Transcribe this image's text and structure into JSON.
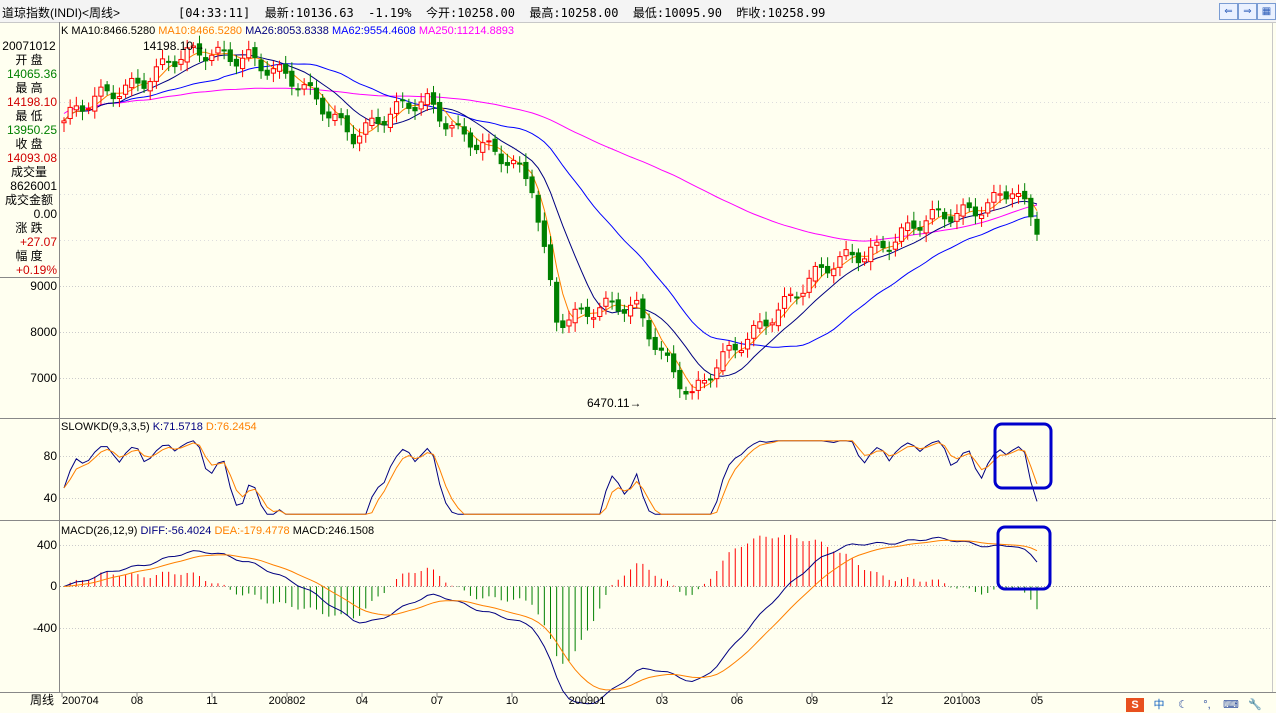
{
  "window": {
    "title": "道琼指数(INDI)<周线>",
    "info": "[04:33:11]  最新:10136.63  -1.19%  今开:10258.00  最高:10258.00  最低:10095.90  昨收:10258.99",
    "nav_buttons": [
      "prev-icon",
      "next-icon",
      "grid-icon"
    ]
  },
  "main_panel": {
    "legend": [
      {
        "text": "K",
        "color": "#000000"
      },
      {
        "text": "MA10:8466.5280",
        "color": "#000000"
      },
      {
        "text": "MA10:8466.5280",
        "color": "#ff8000"
      },
      {
        "text": "MA26:8053.8338",
        "color": "#000080"
      },
      {
        "text": "MA62:9554.4608",
        "color": "#0000ff"
      },
      {
        "text": "MA250:11214.8893",
        "color": "#ff00ff"
      }
    ],
    "high_marker": "14198.10→",
    "low_marker": "6470.11→",
    "yticks": [
      "9000",
      "8000",
      "7000"
    ]
  },
  "info_panel": {
    "date": "20071012",
    "open_label": "开  盘",
    "open": "14065.36",
    "high_label": "最  高",
    "high": "14198.10",
    "low_label": "最  低",
    "low": "13950.25",
    "close_label": "收  盘",
    "close": "14093.08",
    "vol_label": "成交量",
    "vol": "8626001",
    "amount_label": "成交金额",
    "amount": "0.00",
    "chg_label": "涨  跌",
    "chg": "+27.07",
    "pct_label": "幅  度",
    "pct": "+0.19%"
  },
  "kd_panel": {
    "legend": [
      {
        "text": "SLOWKD(9,3,3,5)",
        "color": "#000000"
      },
      {
        "text": "K:71.5718",
        "color": "#000080"
      },
      {
        "text": "D:76.2454",
        "color": "#ff8000"
      }
    ],
    "yticks": [
      "80",
      "40"
    ]
  },
  "macd_panel": {
    "legend": [
      {
        "text": "MACD(26,12,9)",
        "color": "#000000"
      },
      {
        "text": "DIFF:-56.4024",
        "color": "#000080"
      },
      {
        "text": "DEA:-179.4778",
        "color": "#ff8000"
      },
      {
        "text": "MACD:246.1508",
        "color": "#000000"
      }
    ],
    "yticks": [
      "400",
      "0",
      "-400"
    ]
  },
  "xaxis": {
    "label": "周线",
    "ticks": [
      "200704",
      "08",
      "11",
      "200802",
      "04",
      "07",
      "10",
      "200901",
      "03",
      "06",
      "09",
      "12",
      "201003",
      "05"
    ]
  },
  "status_icons": [
    "sogou-icon",
    "chinese-input-icon",
    "moon-icon",
    "punctuation-icon",
    "keyboard-icon",
    "wrench-icon"
  ],
  "chart_data": {
    "type": "candlestick",
    "title": "道琼指数(INDI)<周线>",
    "period": "weekly",
    "x_range": [
      "200704",
      "201005"
    ],
    "price_ylim": [
      6300,
      14500
    ],
    "price_keypoints": [
      {
        "date": "200704",
        "close": 12600
      },
      {
        "date": "200707",
        "close": 13900
      },
      {
        "date": "200710",
        "close": 14093.08
      },
      {
        "date": "200802",
        "close": 12400
      },
      {
        "date": "200805",
        "close": 13000
      },
      {
        "date": "200809",
        "close": 11200
      },
      {
        "date": "200810",
        "close": 8400
      },
      {
        "date": "200901",
        "close": 8500
      },
      {
        "date": "200903",
        "close": 6600
      },
      {
        "date": "200906",
        "close": 8500
      },
      {
        "date": "200909",
        "close": 9700
      },
      {
        "date": "200912",
        "close": 10400
      },
      {
        "date": "201004",
        "close": 11100
      },
      {
        "date": "201005",
        "close": 10136.63
      }
    ],
    "annotations": [
      {
        "label": "14198.10",
        "date": "200710",
        "value": 14198.1
      },
      {
        "label": "6470.11",
        "date": "200903",
        "value": 6470.11
      }
    ],
    "indicators": {
      "MA10": 8466.528,
      "MA26": 8053.8338,
      "MA62": 9554.4608,
      "MA250": 11214.8893,
      "SLOWKD": {
        "params": "9,3,3,5",
        "K": 71.5718,
        "D": 76.2454
      },
      "MACD": {
        "params": "26,12,9",
        "DIFF": -56.4024,
        "DEA": -179.4778,
        "MACD": 246.1508
      }
    },
    "colors": {
      "up": "#ff0000",
      "down": "#008000",
      "ma10": "#ff8000",
      "ma26": "#000080",
      "ma62": "#0000ff",
      "ma250": "#ff00ff",
      "highlight": "#0000cc"
    }
  }
}
